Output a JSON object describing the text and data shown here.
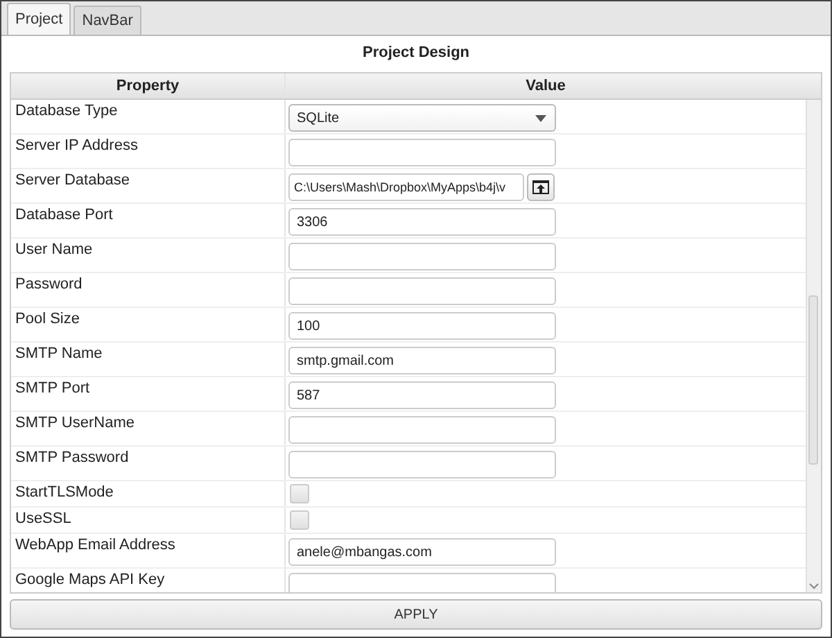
{
  "tabs": [
    {
      "label": "Project",
      "selected": true
    },
    {
      "label": "NavBar",
      "selected": false
    }
  ],
  "title": "Project Design",
  "table": {
    "columns": [
      "Property",
      "Value"
    ],
    "rows": [
      {
        "property": "Database Type",
        "kind": "dropdown",
        "value": "SQLite"
      },
      {
        "property": "Server IP Address",
        "kind": "text"
      },
      {
        "property": "Server Database",
        "kind": "file",
        "value": "C:\\Users\\Mash\\Dropbox\\MyApps\\b4j\\v"
      },
      {
        "property": "Database Port",
        "kind": "text",
        "value": "3306"
      },
      {
        "property": "User Name",
        "kind": "text"
      },
      {
        "property": "Password",
        "kind": "text"
      },
      {
        "property": "Pool Size",
        "kind": "text",
        "value": "100"
      },
      {
        "property": "SMTP Name",
        "kind": "text",
        "value": "smtp.gmail.com"
      },
      {
        "property": "SMTP Port",
        "kind": "text",
        "value": "587"
      },
      {
        "property": "SMTP UserName",
        "kind": "text"
      },
      {
        "property": "SMTP Password",
        "kind": "text"
      },
      {
        "property": "StartTLSMode",
        "kind": "checkbox",
        "checked": false
      },
      {
        "property": "UseSSL",
        "kind": "checkbox",
        "checked": false
      },
      {
        "property": "WebApp Email Address",
        "kind": "text",
        "value": "anele@mbangas.com"
      },
      {
        "property": "Google Maps API Key",
        "kind": "text"
      }
    ]
  },
  "apply_button": "APPLY"
}
